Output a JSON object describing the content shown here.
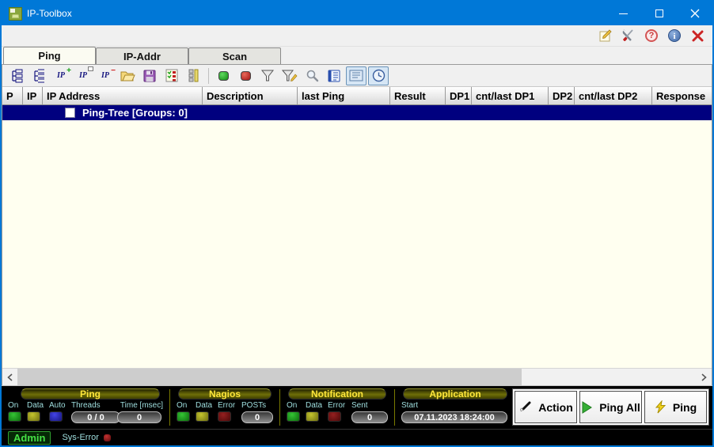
{
  "window": {
    "title": "IP-Toolbox"
  },
  "tabs": {
    "ping": "Ping",
    "ipaddr": "IP-Addr",
    "scan": "Scan"
  },
  "table": {
    "columns": [
      "P",
      "IP",
      "IP Address",
      "Description",
      "last Ping",
      "Result",
      "DP1",
      "cnt/last DP1",
      "DP2",
      "cnt/last DP2",
      "Response"
    ],
    "tree_root_label": "Ping-Tree [Groups: 0]"
  },
  "panel": {
    "ping": {
      "title": "Ping",
      "col_on": "On",
      "col_data": "Data",
      "col_auto": "Auto",
      "col_threads": "Threads",
      "col_time": "Time [msec]",
      "threads_value": "0 / 0",
      "time_value": "0"
    },
    "nagios": {
      "title": "Nagios",
      "col_on": "On",
      "col_data": "Data",
      "col_error": "Error",
      "col_posts": "POSTs",
      "posts_value": "0"
    },
    "notification": {
      "title": "Notification",
      "col_on": "On",
      "col_data": "Data",
      "col_error": "Error",
      "col_sent": "Sent",
      "sent_value": "0"
    },
    "application": {
      "title": "Application",
      "col_start": "Start",
      "start_value": "07.11.2023 18:24:00"
    },
    "buttons": {
      "action": "Action",
      "ping_all": "Ping All",
      "ping": "Ping"
    }
  },
  "statusbar": {
    "admin": "Admin",
    "sys_error": "Sys-Error"
  },
  "icons": {
    "titlebar": [
      "app-icon",
      "minimize-icon",
      "maximize-icon",
      "close-icon"
    ],
    "toolstrip": [
      "edit-note-icon",
      "settings-tools-icon",
      "help-icon",
      "info-icon",
      "exit-icon"
    ],
    "toolbar": [
      "expand-tree-icon",
      "collapse-tree-icon",
      "add-ip-icon",
      "edit-ip-icon",
      "remove-ip-icon",
      "open-file-icon",
      "save-file-icon",
      "check-list-icon",
      "column-list-icon",
      "start-green-led-icon",
      "stop-red-led-icon",
      "filter-icon",
      "filter-edit-icon",
      "search-icon",
      "log-book-icon",
      "notes-icon",
      "clock-icon"
    ],
    "buttons": [
      "wand-icon",
      "play-icon",
      "lightning-icon"
    ],
    "scrollbar": [
      "scroll-left-icon",
      "scroll-right-icon"
    ]
  },
  "colors": {
    "titlebar_blue": "#0078d7",
    "selected_row_navy": "#00007f",
    "table_body_ivory": "#fffff0",
    "panel_black": "#000000",
    "header_yellow": "#ffe63a",
    "label_cyan": "#9fdede",
    "admin_green": "#45e045",
    "led_green": "#35c435",
    "led_olive": "#c5c52e",
    "led_blue": "#4444e8",
    "led_darkred": "#952020"
  }
}
